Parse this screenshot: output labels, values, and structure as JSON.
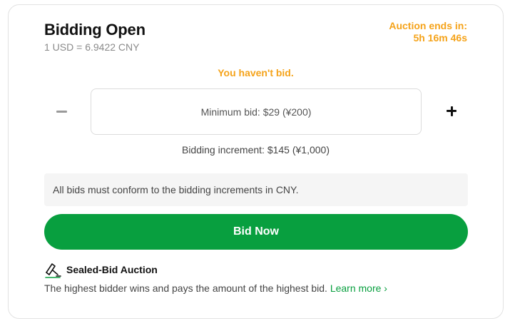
{
  "header": {
    "title": "Bidding Open",
    "exchange_rate": "1 USD = 6.9422 CNY",
    "auction_ends_label": "Auction ends in:",
    "auction_ends_time": "5h 16m 46s"
  },
  "bid": {
    "status": "You haven't bid.",
    "input_placeholder": "Minimum bid: $29 (¥200)",
    "increment_text": "Bidding increment: $145 (¥1,000)",
    "decrease_icon": "minus-icon",
    "increase_icon": "plus-icon"
  },
  "notice": {
    "text": "All bids must conform to the bidding increments in CNY."
  },
  "actions": {
    "bid_now_label": "Bid Now"
  },
  "sealed": {
    "icon": "gavel-icon",
    "title": "Sealed-Bid Auction",
    "description": "The highest bidder wins and pays the amount of the highest bid.",
    "learn_more_label": "Learn more ›"
  },
  "colors": {
    "accent_orange": "#f5a31a",
    "primary_green": "#089f3f",
    "notice_bg": "#f5f5f5"
  }
}
